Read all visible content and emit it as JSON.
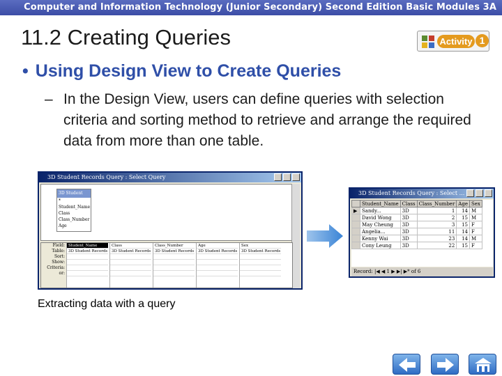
{
  "banner": {
    "text": "Computer and Information Technology (Junior Secondary) Second Edition Basic Modules 3A"
  },
  "slide": {
    "title": "11.2  Creating Queries",
    "activity_label": "Activity",
    "activity_number": "1",
    "bullet1": "Using Design View to Create Queries",
    "bullet2_dash": "–",
    "bullet2": "In the Design View, users can define queries with selection criteria and sorting method to retrieve and arrange the required data from more than one table.",
    "caption": "Extracting data with a query"
  },
  "design_window": {
    "title": "3D Student Records Query : Select Query",
    "field_list_title": "3D Student",
    "field_list_items": [
      "*",
      "Student_Name",
      "Class",
      "Class_Number",
      "Age"
    ],
    "row_labels": [
      "Field:",
      "Table:",
      "Sort:",
      "Show:",
      "Criteria:",
      "or:"
    ],
    "columns": [
      {
        "field": "Student_Name",
        "table": "3D Student Records"
      },
      {
        "field": "Class",
        "table": "3D Student Records"
      },
      {
        "field": "Class_Number",
        "table": "3D Student Records"
      },
      {
        "field": "Age",
        "table": "3D Student Records"
      },
      {
        "field": "Sex",
        "table": "3D Student Records"
      }
    ]
  },
  "result_window": {
    "title": "3D Student Records Query : Select ...",
    "headers": [
      "Student_Name",
      "Class",
      "Class_Number",
      "Age",
      "Sex"
    ],
    "rows": [
      [
        "Sandy...",
        "3D",
        "1",
        "14",
        "M"
      ],
      [
        "David Wong",
        "3D",
        "2",
        "15",
        "M"
      ],
      [
        "May Cheung",
        "3D",
        "3",
        "15",
        "F"
      ],
      [
        "Angelia...",
        "3D",
        "11",
        "14",
        "F"
      ],
      [
        "Kenny Wai",
        "3D",
        "23",
        "14",
        "M"
      ],
      [
        "Cony Leung",
        "3D",
        "22",
        "15",
        "F"
      ]
    ],
    "navigation": "Record: |◀ ◀ 1 ▶ ▶| ▶* of 6"
  },
  "nav": {
    "prev": "previous",
    "next": "next",
    "home": "home"
  },
  "colors": {
    "title_blue": "#2f4fa8",
    "banner": "#3c4da6",
    "activity_orange": "#e49a1e"
  }
}
